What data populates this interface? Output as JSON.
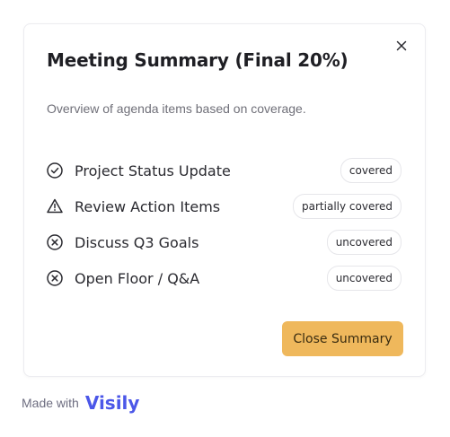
{
  "dialog": {
    "title": "Meeting Summary (Final 20%)",
    "subtitle": "Overview of agenda items based on coverage.",
    "close_icon": "close-icon",
    "items": [
      {
        "label": "Project Status Update",
        "status": "covered",
        "icon": "check-circle-icon"
      },
      {
        "label": "Review Action Items",
        "status": "partially covered",
        "icon": "warning-triangle-icon"
      },
      {
        "label": "Discuss Q3 Goals",
        "status": "uncovered",
        "icon": "x-circle-icon"
      },
      {
        "label": "Open Floor / Q&A",
        "status": "uncovered",
        "icon": "x-circle-icon"
      }
    ],
    "primary_button_label": "Close Summary"
  },
  "footer": {
    "made_with": "Made with",
    "brand": "Visily"
  },
  "colors": {
    "accent": "#efb85c",
    "brand": "#4b57e8",
    "text": "#2a2a30",
    "muted": "#6f6f78"
  }
}
